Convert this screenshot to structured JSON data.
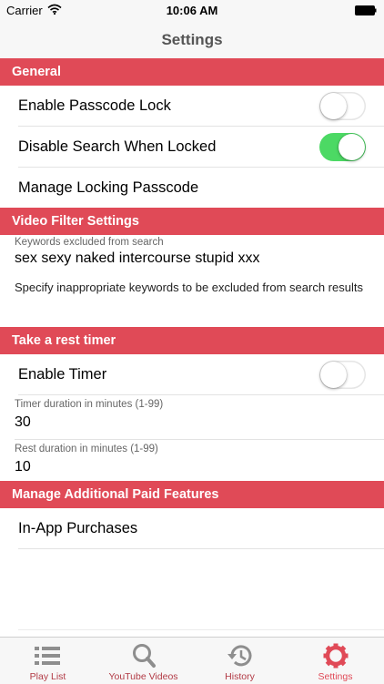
{
  "status_bar": {
    "carrier": "Carrier",
    "time": "10:06 AM"
  },
  "nav": {
    "title": "Settings"
  },
  "sections": {
    "general": {
      "header": "General",
      "rows": [
        "Enable Passcode Lock",
        "Disable Search When Locked",
        "Manage Locking Passcode"
      ],
      "toggles": [
        false,
        true
      ]
    },
    "video_filter": {
      "header": "Video Filter Settings",
      "keywords_label": "Keywords excluded from search",
      "keywords_value": "sex sexy naked intercourse stupid xxx",
      "note": "Specify inappropriate keywords to be excluded from search results"
    },
    "rest_timer": {
      "header": "Take a rest timer",
      "enable_label": "Enable Timer",
      "enable_toggle": false,
      "timer_label": "Timer duration in minutes (1-99)",
      "timer_value": "30",
      "rest_label": "Rest duration in minutes (1-99)",
      "rest_value": "10"
    },
    "paid": {
      "header": "Manage Additional Paid Features",
      "row": "In-App Purchases"
    }
  },
  "tabs": [
    {
      "label": "Play List",
      "icon": "list-icon"
    },
    {
      "label": "YouTube Videos",
      "icon": "search-icon"
    },
    {
      "label": "History",
      "icon": "history-icon"
    },
    {
      "label": "Settings",
      "icon": "gear-icon",
      "active": true
    }
  ],
  "colors": {
    "accent": "#e04a57",
    "toggle_on": "#4cd964",
    "tab_inactive": "#b23a45"
  }
}
